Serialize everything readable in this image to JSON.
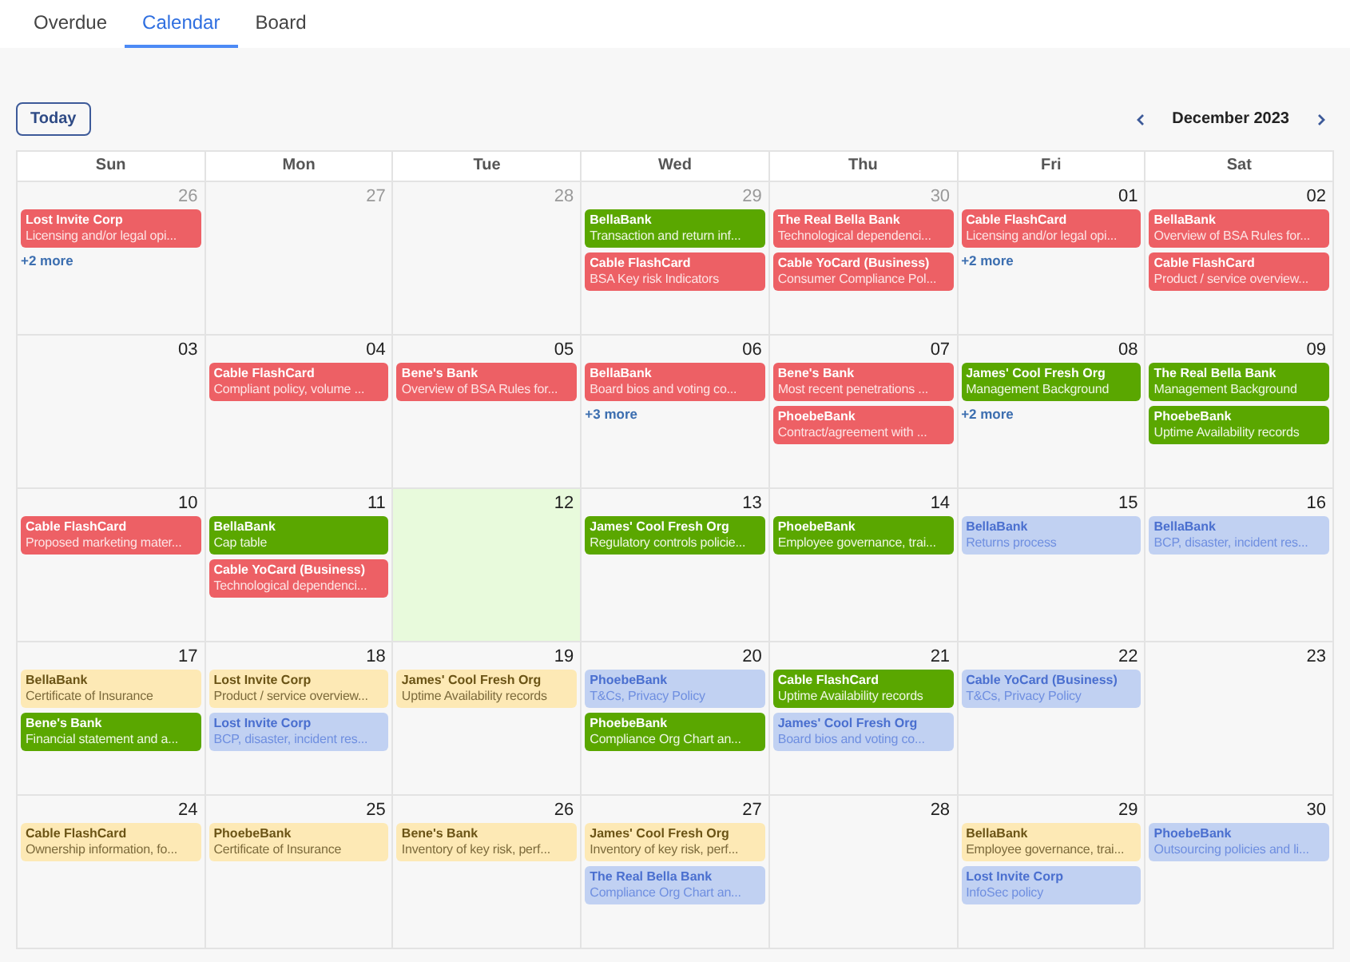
{
  "tabs": [
    {
      "label": "Overdue",
      "selected": false
    },
    {
      "label": "Calendar",
      "selected": true
    },
    {
      "label": "Board",
      "selected": false
    }
  ],
  "toolbar": {
    "today_button": "Today",
    "month_label": "December 2023"
  },
  "weekdays": [
    "Sun",
    "Mon",
    "Tue",
    "Wed",
    "Thu",
    "Fri",
    "Sat"
  ],
  "weeks": [
    [
      {
        "day": "26",
        "muted": true,
        "today": false,
        "events": [
          {
            "title": "Lost Invite Corp",
            "detail": "Licensing and/or legal opi...",
            "color": "#ed6065"
          }
        ],
        "more": "+2 more"
      },
      {
        "day": "27",
        "muted": true,
        "today": false
      },
      {
        "day": "28",
        "muted": true,
        "today": false
      },
      {
        "day": "29",
        "muted": true,
        "today": false,
        "events": [
          {
            "title": "BellaBank",
            "detail": "Transaction and return inf...",
            "color": "#5aa700"
          },
          {
            "title": "Cable FlashCard",
            "detail": "BSA Key risk Indicators",
            "color": "#ed6065"
          }
        ]
      },
      {
        "day": "30",
        "muted": true,
        "today": false,
        "events": [
          {
            "title": "The Real Bella Bank",
            "detail": "Technological dependenci...",
            "color": "#ed6065"
          },
          {
            "title": "Cable YoCard (Business)",
            "detail": "Consumer Compliance Pol...",
            "color": "#ed6065"
          }
        ]
      },
      {
        "day": "01",
        "muted": false,
        "today": false,
        "events": [
          {
            "title": "Cable FlashCard",
            "detail": "Licensing and/or legal opi...",
            "color": "#ed6065"
          }
        ],
        "more": "+2 more"
      },
      {
        "day": "02",
        "muted": false,
        "today": false,
        "events": [
          {
            "title": "BellaBank",
            "detail": "Overview of BSA Rules for...",
            "color": "#ed6065"
          },
          {
            "title": "Cable FlashCard",
            "detail": "Product / service overview...",
            "color": "#ed6065"
          }
        ]
      }
    ],
    [
      {
        "day": "03",
        "muted": false,
        "today": false
      },
      {
        "day": "04",
        "muted": false,
        "today": false,
        "events": [
          {
            "title": "Cable FlashCard",
            "detail": "Compliant policy, volume ...",
            "color": "#ed6065"
          }
        ]
      },
      {
        "day": "05",
        "muted": false,
        "today": false,
        "events": [
          {
            "title": "Bene's Bank",
            "detail": "Overview of BSA Rules for...",
            "color": "#ed6065"
          }
        ]
      },
      {
        "day": "06",
        "muted": false,
        "today": false,
        "events": [
          {
            "title": "BellaBank",
            "detail": "Board bios and voting co...",
            "color": "#ed6065"
          }
        ],
        "more": "+3 more"
      },
      {
        "day": "07",
        "muted": false,
        "today": false,
        "events": [
          {
            "title": "Bene's Bank",
            "detail": "Most recent penetrations ...",
            "color": "#ed6065"
          },
          {
            "title": "PhoebeBank",
            "detail": "Contract/agreement with ...",
            "color": "#ed6065"
          }
        ]
      },
      {
        "day": "08",
        "muted": false,
        "today": false,
        "events": [
          {
            "title": "James' Cool Fresh Org",
            "detail": "Management Background",
            "color": "#5aa700"
          }
        ],
        "more": "+2 more"
      },
      {
        "day": "09",
        "muted": false,
        "today": false,
        "events": [
          {
            "title": "The Real Bella Bank",
            "detail": "Management Background",
            "color": "#5aa700"
          },
          {
            "title": "PhoebeBank",
            "detail": "Uptime Availability records",
            "color": "#5aa700"
          }
        ]
      }
    ],
    [
      {
        "day": "10",
        "muted": false,
        "today": false,
        "events": [
          {
            "title": "Cable FlashCard",
            "detail": "Proposed marketing mater...",
            "color": "#ed6065"
          }
        ]
      },
      {
        "day": "11",
        "muted": false,
        "today": false,
        "events": [
          {
            "title": "BellaBank",
            "detail": "Cap table",
            "color": "#5aa700"
          },
          {
            "title": "Cable YoCard (Business)",
            "detail": "Technological dependenci...",
            "color": "#ed6065"
          }
        ]
      },
      {
        "day": "12",
        "muted": false,
        "today": true
      },
      {
        "day": "13",
        "muted": false,
        "today": false,
        "events": [
          {
            "title": "James' Cool Fresh Org",
            "detail": "Regulatory controls policie...",
            "color": "#5aa700"
          }
        ]
      },
      {
        "day": "14",
        "muted": false,
        "today": false,
        "events": [
          {
            "title": "PhoebeBank",
            "detail": "Employee governance, trai...",
            "color": "#5aa700"
          }
        ]
      },
      {
        "day": "15",
        "muted": false,
        "today": false,
        "events": [
          {
            "title": "BellaBank",
            "detail": "Returns process",
            "color": "#c1d1f2"
          }
        ]
      },
      {
        "day": "16",
        "muted": false,
        "today": false,
        "events": [
          {
            "title": "BellaBank",
            "detail": "BCP, disaster, incident res...",
            "color": "#c1d1f2"
          }
        ]
      }
    ],
    [
      {
        "day": "17",
        "muted": false,
        "today": false,
        "events": [
          {
            "title": "BellaBank",
            "detail": "Certificate of Insurance",
            "color": "#fde9b5"
          },
          {
            "title": "Bene's Bank",
            "detail": "Financial statement and a...",
            "color": "#5aa700"
          }
        ]
      },
      {
        "day": "18",
        "muted": false,
        "today": false,
        "events": [
          {
            "title": "Lost Invite Corp",
            "detail": "Product / service overview...",
            "color": "#fde9b5"
          },
          {
            "title": "Lost Invite Corp",
            "detail": "BCP, disaster, incident res...",
            "color": "#c1d1f2"
          }
        ]
      },
      {
        "day": "19",
        "muted": false,
        "today": false,
        "events": [
          {
            "title": "James' Cool Fresh Org",
            "detail": "Uptime Availability records",
            "color": "#fde9b5"
          }
        ]
      },
      {
        "day": "20",
        "muted": false,
        "today": false,
        "events": [
          {
            "title": "PhoebeBank",
            "detail": "T&Cs, Privacy Policy",
            "color": "#c1d1f2"
          },
          {
            "title": "PhoebeBank",
            "detail": "Compliance Org Chart an...",
            "color": "#5aa700"
          }
        ]
      },
      {
        "day": "21",
        "muted": false,
        "today": false,
        "events": [
          {
            "title": "Cable FlashCard",
            "detail": "Uptime Availability records",
            "color": "#5aa700"
          },
          {
            "title": "James' Cool Fresh Org",
            "detail": "Board bios and voting co...",
            "color": "#c1d1f2"
          }
        ]
      },
      {
        "day": "22",
        "muted": false,
        "today": false,
        "events": [
          {
            "title": "Cable YoCard (Business)",
            "detail": "T&Cs, Privacy Policy",
            "color": "#c1d1f2"
          }
        ]
      },
      {
        "day": "23",
        "muted": false,
        "today": false
      }
    ],
    [
      {
        "day": "24",
        "muted": false,
        "today": false,
        "events": [
          {
            "title": "Cable FlashCard",
            "detail": "Ownership information, fo...",
            "color": "#fde9b5"
          }
        ]
      },
      {
        "day": "25",
        "muted": false,
        "today": false,
        "events": [
          {
            "title": "PhoebeBank",
            "detail": "Certificate of Insurance",
            "color": "#fde9b5"
          }
        ]
      },
      {
        "day": "26",
        "muted": false,
        "today": false,
        "events": [
          {
            "title": "Bene's Bank",
            "detail": "Inventory of key risk, perf...",
            "color": "#fde9b5"
          }
        ]
      },
      {
        "day": "27",
        "muted": false,
        "today": false,
        "events": [
          {
            "title": "James' Cool Fresh Org",
            "detail": "Inventory of key risk, perf...",
            "color": "#fde9b5"
          },
          {
            "title": "The Real Bella Bank",
            "detail": "Compliance Org Chart an...",
            "color": "#c1d1f2"
          }
        ]
      },
      {
        "day": "28",
        "muted": false,
        "today": false
      },
      {
        "day": "29",
        "muted": false,
        "today": false,
        "events": [
          {
            "title": "BellaBank",
            "detail": "Employee governance, trai...",
            "color": "#fde9b5"
          },
          {
            "title": "Lost Invite Corp",
            "detail": "InfoSec policy",
            "color": "#c1d1f2"
          }
        ]
      },
      {
        "day": "30",
        "muted": false,
        "today": false,
        "events": [
          {
            "title": "PhoebeBank",
            "detail": "Outsourcing policies and li...",
            "color": "#c1d1f2"
          }
        ]
      }
    ]
  ]
}
